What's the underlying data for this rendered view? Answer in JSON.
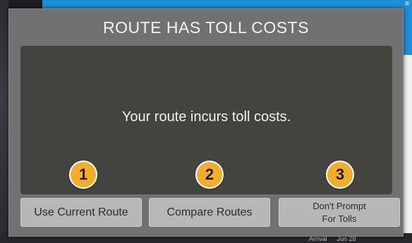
{
  "dialog": {
    "title": "ROUTE HAS TOLL COSTS",
    "message": "Your route incurs toll costs."
  },
  "buttons": {
    "use_current_route": "Use Current Route",
    "compare_routes": "Compare Routes",
    "dont_prompt_line1": "Don't Prompt",
    "dont_prompt_line2": "For Tolls"
  },
  "badges": {
    "one": "1",
    "two": "2",
    "three": "3"
  },
  "background": {
    "arrival_label": "Arrival",
    "arrival_date": "Jun 28"
  },
  "colors": {
    "dialog_frame": "#717171",
    "dialog_body": "#434340",
    "button": "#b7b7b7",
    "badge": "#f3ad2b",
    "map_accent": "#1f8fd6"
  },
  "icons": {
    "menu": "menu-icon"
  }
}
